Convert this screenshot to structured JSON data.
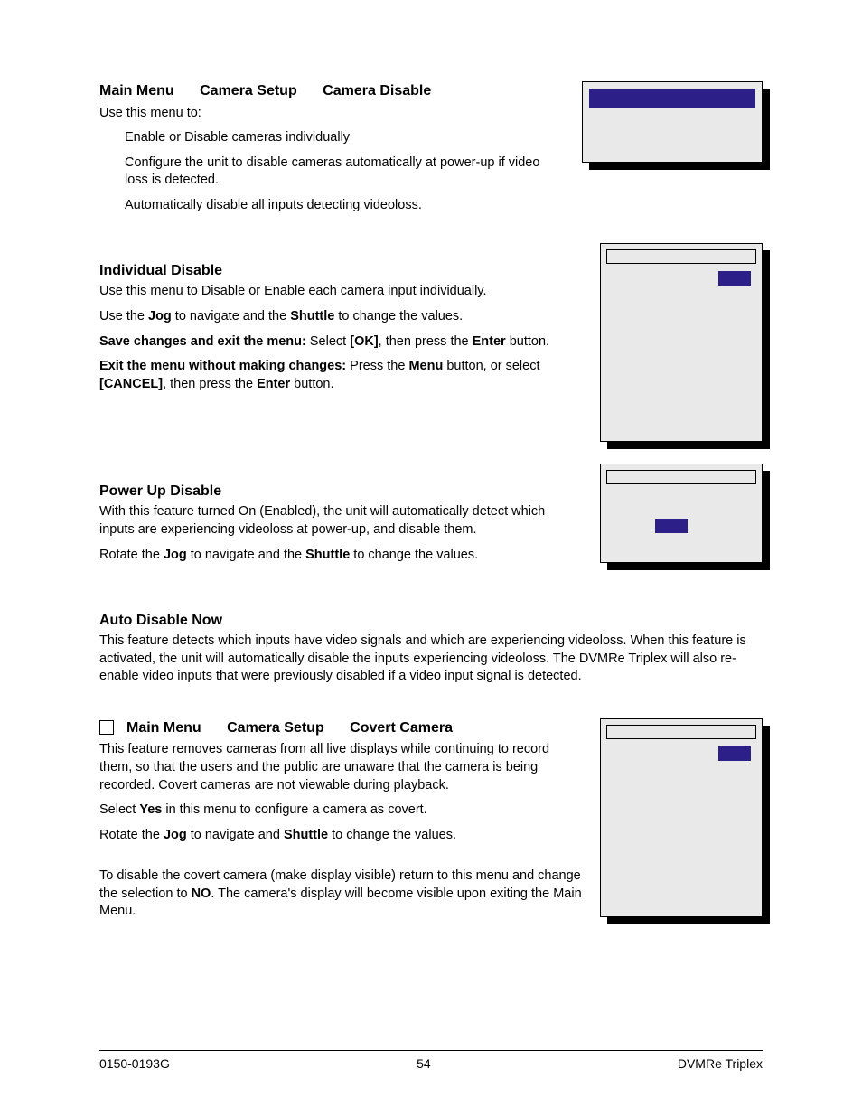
{
  "sections": {
    "s1": {
      "crumb1": "Main Menu",
      "crumb2": "Camera Setup",
      "crumb3": "Camera Disable",
      "intro": "Use this menu to:",
      "b1": "Enable or Disable cameras individually",
      "b2": "Configure the unit to disable cameras automatically at power-up if video loss is detected.",
      "b3": "Automatically disable all inputs detecting videoloss."
    },
    "s2": {
      "title": "Individual Disable",
      "p1": "Use this menu to Disable or Enable each camera input individually.",
      "p2a": "Use the ",
      "p2b": "Jog",
      "p2c": " to navigate and the ",
      "p2d": "Shuttle",
      "p2e": " to change the values.",
      "p3a": "Save changes and exit the menu:  ",
      "p3b": "Select ",
      "p3c": "[OK]",
      "p3d": ", then press the ",
      "p3e": "Enter",
      "p3f": " button.",
      "p4a": "Exit the menu without making changes:  ",
      "p4b": "Press the ",
      "p4c": "Menu",
      "p4d": " button, or select ",
      "p4e": "[CANCEL]",
      "p4f": ", then press the ",
      "p4g": "Enter",
      "p4h": " button."
    },
    "s3": {
      "title": "Power Up Disable",
      "p1": "With this feature turned On (Enabled), the unit will automatically detect which inputs are experiencing videoloss at power-up, and disable them.",
      "p2a": "Rotate the ",
      "p2b": "Jog",
      "p2c": " to navigate and the ",
      "p2d": "Shuttle",
      "p2e": " to change the values."
    },
    "s4": {
      "title": "Auto Disable Now",
      "p1": "This feature detects which inputs have video signals and which are experiencing videoloss.  When this feature is activated, the unit will automatically disable the inputs experiencing videoloss.  The DVMRe Triplex will also re-enable video inputs that were previously disabled if a video input signal is detected."
    },
    "s5": {
      "crumb1": "Main Menu",
      "crumb2": "Camera Setup",
      "crumb3": "Covert Camera",
      "p1": "This feature removes cameras from all live displays while continuing to record them, so that the users and the public are unaware that the camera is being recorded.  Covert cameras are not viewable during playback.",
      "p2a": "Select ",
      "p2b": "Yes",
      "p2c": " in this menu to configure a camera as covert.",
      "p3a": "Rotate the ",
      "p3b": "Jog",
      "p3c": " to navigate and ",
      "p3d": "Shuttle",
      "p3e": " to change the values.",
      "p4a": "To disable the covert camera (make display visible) return to this menu and change the selection to ",
      "p4b": "NO",
      "p4c": ". The camera's display will become visible upon exiting the Main Menu."
    }
  },
  "footer": {
    "left": "0150-0193G",
    "center": "54",
    "right": "DVMRe Triplex"
  }
}
